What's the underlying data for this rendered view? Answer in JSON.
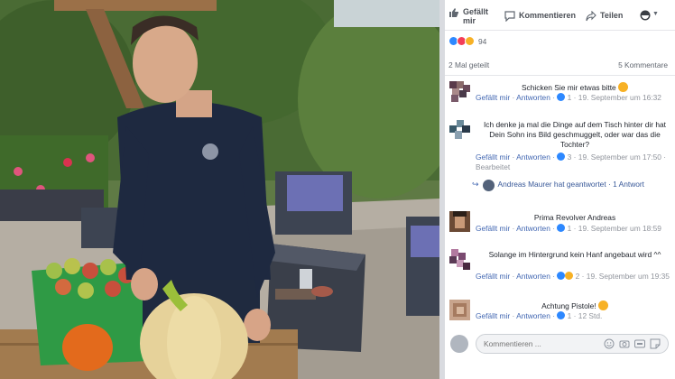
{
  "actions": {
    "like_label": "Gefällt mir",
    "comment_label": "Kommentieren",
    "share_label": "Teilen"
  },
  "reactions": {
    "count": "94"
  },
  "stats": {
    "shares": "2 Mal geteilt",
    "comments": "5 Kommentare"
  },
  "comments": [
    {
      "text": "Schicken Sie mir etwas bitte",
      "like": "Gefällt mir",
      "reply": "Antworten",
      "reactions": "1",
      "date": "19. September um 16:32"
    },
    {
      "text": "Ich denke ja mal die Dinge auf dem Tisch hinter dir hat Dein Sohn ins Bild geschmuggelt, oder war das die Tochter?",
      "like": "Gefällt mir",
      "reply": "Antworten",
      "reactions": "3",
      "date": "19. September um 17:50",
      "edited": "Bearbeitet"
    },
    {
      "text": "Prima Revolver Andreas",
      "like": "Gefällt mir",
      "reply": "Antworten",
      "reactions": "1",
      "date": "19. September um 18:59"
    },
    {
      "text": "Solange im Hintergrund kein Hanf angebaut wird ^^",
      "like": "Gefällt mir",
      "reply": "Antworten",
      "reactions": "2",
      "date": "19. September um 19:35"
    },
    {
      "text": "Achtung Pistole!",
      "like": "Gefällt mir",
      "reply": "Antworten",
      "reactions": "1",
      "date": "12 Std."
    }
  ],
  "reply_summary": "Andreas Maurer hat geantwortet · 1 Antwort",
  "compose": {
    "placeholder": "Kommentieren ..."
  },
  "colors": {
    "facebook_blue": "#4267b2",
    "panel_bg": "#ffffff",
    "meta_gray": "#90949c"
  },
  "icons": [
    "thumbs-up-icon",
    "comment-icon",
    "share-icon",
    "reaction-picker-icon",
    "emoji-icon",
    "camera-icon",
    "gif-icon",
    "sticker-icon",
    "reply-arrow-icon"
  ]
}
